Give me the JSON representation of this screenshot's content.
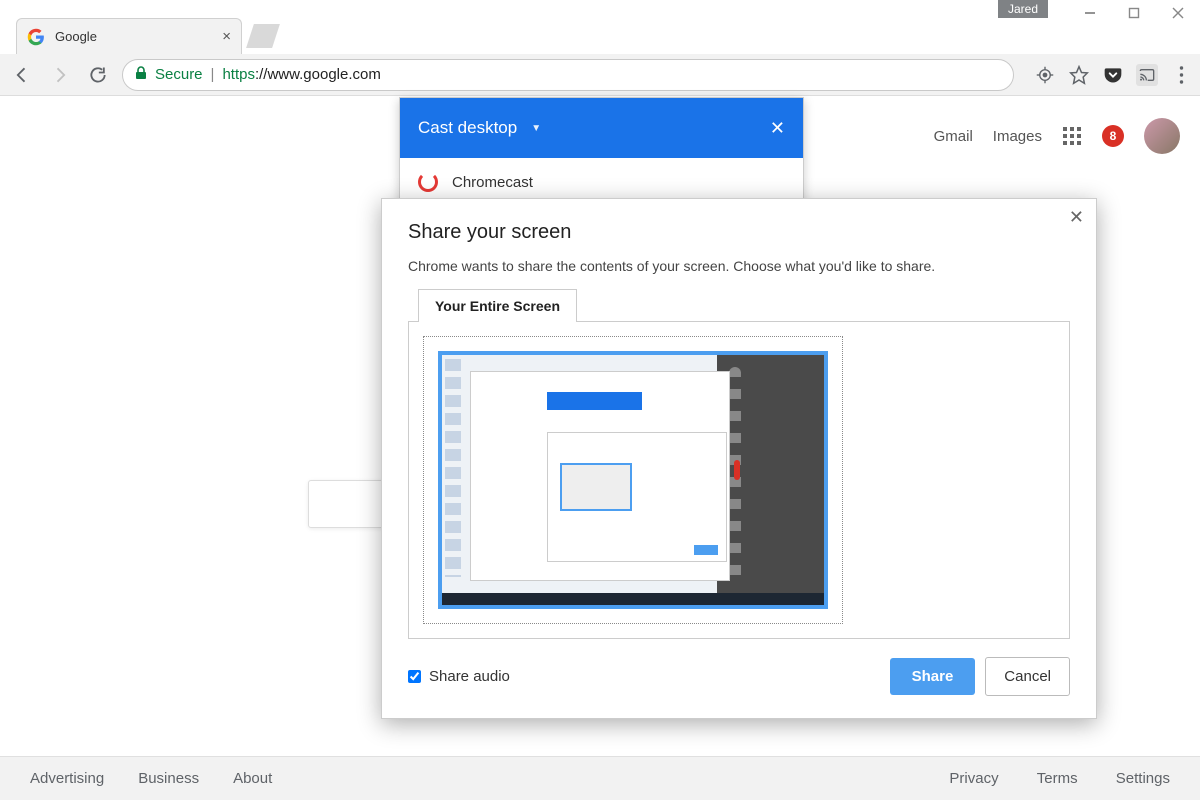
{
  "window": {
    "user_tag": "Jared"
  },
  "tab": {
    "title": "Google"
  },
  "omnibox": {
    "secure_label": "Secure",
    "protocol": "https",
    "url_rest": "://www.google.com"
  },
  "google_header": {
    "gmail": "Gmail",
    "images": "Images",
    "notif_count": "8"
  },
  "cast_popup": {
    "title": "Cast desktop",
    "device": "Chromecast"
  },
  "share_dialog": {
    "title": "Share your screen",
    "description": "Chrome wants to share the contents of your screen. Choose what you'd like to share.",
    "tab_label": "Your Entire Screen",
    "share_audio": "Share audio",
    "share_btn": "Share",
    "cancel_btn": "Cancel"
  },
  "footer": {
    "advertising": "Advertising",
    "business": "Business",
    "about": "About",
    "privacy": "Privacy",
    "terms": "Terms",
    "settings": "Settings"
  }
}
